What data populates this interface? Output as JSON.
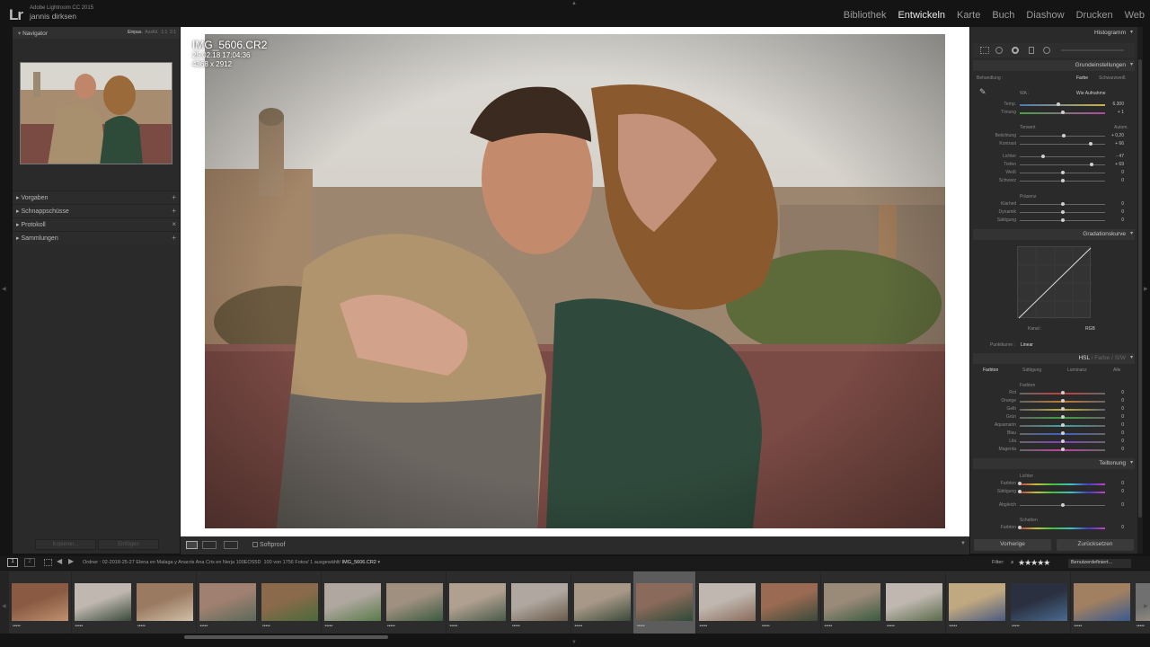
{
  "app": {
    "logo": "Lr",
    "product": "Adobe Lightroom CC 2015",
    "user": "jannis dirksen"
  },
  "modules": [
    "Bibliothek",
    "Entwickeln",
    "Karte",
    "Buch",
    "Diashow",
    "Drucken",
    "Web"
  ],
  "active_module": "Entwickeln",
  "navigator": {
    "title": "Navigator",
    "zoom": [
      "Einpas.",
      "Ausfül.",
      "1:1",
      "2:1"
    ]
  },
  "left_sections": [
    {
      "label": "Vorgaben",
      "action": "+"
    },
    {
      "label": "Schnappschüsse",
      "action": "+"
    },
    {
      "label": "Protokoll",
      "action": "×"
    },
    {
      "label": "Sammlungen",
      "action": "+"
    }
  ],
  "left_buttons": {
    "copy": "Kopieren...",
    "paste": "Einfügen"
  },
  "photo": {
    "name": "IMG_5606.CR2",
    "date": "25.02.18 17:04:36",
    "dimensions": "4368 x 2912"
  },
  "toolbar": {
    "softproof": "Softproof"
  },
  "histogram": {
    "title": "Histogramm"
  },
  "basic": {
    "title": "Grundeinstellungen",
    "treatment_label": "Behandlung :",
    "treatment_color": "Farbe",
    "treatment_bw": "Schwarzweiß",
    "wb_label": "WA :",
    "wb_value": "Wie Aufnahme",
    "tone_label": "Tonwert",
    "tone_auto": "Autom.",
    "presence_label": "Präsenz",
    "sliders": [
      {
        "label": "Temp.",
        "value": "6.300",
        "pos": 0.45
      },
      {
        "label": "Tönung",
        "value": "+ 1",
        "pos": 0.5
      },
      {
        "label": "Belichtung",
        "value": "+ 0,20",
        "pos": 0.52
      },
      {
        "label": "Kontrast",
        "value": "+ 66",
        "pos": 0.83
      },
      {
        "label": "Lichter",
        "value": "- 47",
        "pos": 0.27
      },
      {
        "label": "Tiefen",
        "value": "+ 69",
        "pos": 0.84
      },
      {
        "label": "Weiß",
        "value": "0",
        "pos": 0.5
      },
      {
        "label": "Schwarz",
        "value": "0",
        "pos": 0.5
      },
      {
        "label": "Klarheit",
        "value": "0",
        "pos": 0.5
      },
      {
        "label": "Dynamik",
        "value": "0",
        "pos": 0.5
      },
      {
        "label": "Sättigung",
        "value": "0",
        "pos": 0.5
      }
    ]
  },
  "curve": {
    "title": "Gradationskurve",
    "channel_label": "Kanal :",
    "channel_value": "RGB",
    "curve_label": "Punktkurve :",
    "curve_value": "Linear"
  },
  "hsl": {
    "title_parts": [
      "HSL",
      "/",
      "Farbe",
      "/",
      "S/W"
    ],
    "tabs": [
      "Farbton",
      "Sättigung",
      "Luminanz",
      "Alle"
    ],
    "group": "Farbton",
    "sliders": [
      {
        "label": "Rot",
        "value": "0"
      },
      {
        "label": "Orange",
        "value": "0"
      },
      {
        "label": "Gelb",
        "value": "0"
      },
      {
        "label": "Grün",
        "value": "0"
      },
      {
        "label": "Aquamarin",
        "value": "0"
      },
      {
        "label": "Blau",
        "value": "0"
      },
      {
        "label": "Lila",
        "value": "0"
      },
      {
        "label": "Magenta",
        "value": "0"
      }
    ]
  },
  "split": {
    "title": "Teiltonung",
    "highlights": "Lichter",
    "shadows": "Schatten",
    "sliders": [
      {
        "label": "Farbton",
        "value": "0",
        "pos": 0.0
      },
      {
        "label": "Sättigung",
        "value": "0",
        "pos": 0.0
      },
      {
        "label": "Abgleich",
        "value": "0",
        "pos": 0.5
      },
      {
        "label": "Farbton",
        "value": "0",
        "pos": 0.0
      }
    ]
  },
  "bottom_buttons": {
    "previous": "Vorherige",
    "reset": "Zurücksetzen"
  },
  "filmstrip": {
    "source_prefix": "Ordner : 02-2018-25-27 Elena en Malaga y Anacris Ana Cris en Nerja 100EOS5D",
    "count": "100 von 1756 Fotos/ 1 ausgewählt/",
    "selected": "IMG_5606.CR2",
    "filter_label": "Filter:",
    "filter_op": "≥",
    "stars": "★★★★★",
    "preset": "Benutzerdefiniert...",
    "page_numbers": [
      "1",
      "2"
    ],
    "rating_dots": "•••••"
  },
  "colors": {
    "bg": "#141414",
    "panel": "#2a2a2a",
    "accent": "#e8e8e8"
  }
}
